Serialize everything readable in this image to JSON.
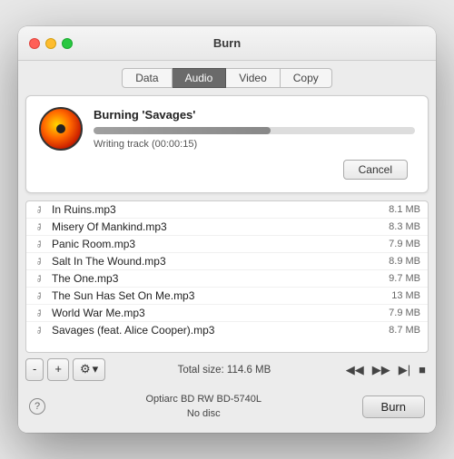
{
  "window": {
    "title": "Burn"
  },
  "tabs": [
    {
      "label": "Data",
      "active": false
    },
    {
      "label": "Audio",
      "active": true
    },
    {
      "label": "Video",
      "active": false
    },
    {
      "label": "Copy",
      "active": false
    }
  ],
  "burn_progress": {
    "title": "Burning 'Savages'",
    "status": "Writing track (00:00:15)",
    "progress_percent": 55,
    "cancel_label": "Cancel"
  },
  "tracks": [
    {
      "name": "In Ruins.mp3",
      "size": "8.1 MB"
    },
    {
      "name": "Misery Of Mankind.mp3",
      "size": "8.3 MB"
    },
    {
      "name": "Panic Room.mp3",
      "size": "7.9 MB"
    },
    {
      "name": "Salt In The Wound.mp3",
      "size": "8.9 MB"
    },
    {
      "name": "The One.mp3",
      "size": "9.7 MB"
    },
    {
      "name": "The Sun Has Set On Me.mp3",
      "size": "13 MB"
    },
    {
      "name": "World War Me.mp3",
      "size": "7.9 MB"
    },
    {
      "name": "Savages (feat. Alice Cooper).mp3",
      "size": "8.7 MB"
    }
  ],
  "toolbar": {
    "minus_label": "-",
    "plus_label": "+",
    "gear_label": "⚙",
    "chevron_label": "▾",
    "total_size_label": "Total size: 114.6 MB"
  },
  "playback": {
    "rewind": "◀◀",
    "fast_forward": "▶▶",
    "end": "▶|",
    "stop": "■"
  },
  "bottom": {
    "help_label": "?",
    "disc_name": "Optiarc BD RW BD-5740L",
    "disc_status": "No disc",
    "burn_label": "Burn"
  }
}
